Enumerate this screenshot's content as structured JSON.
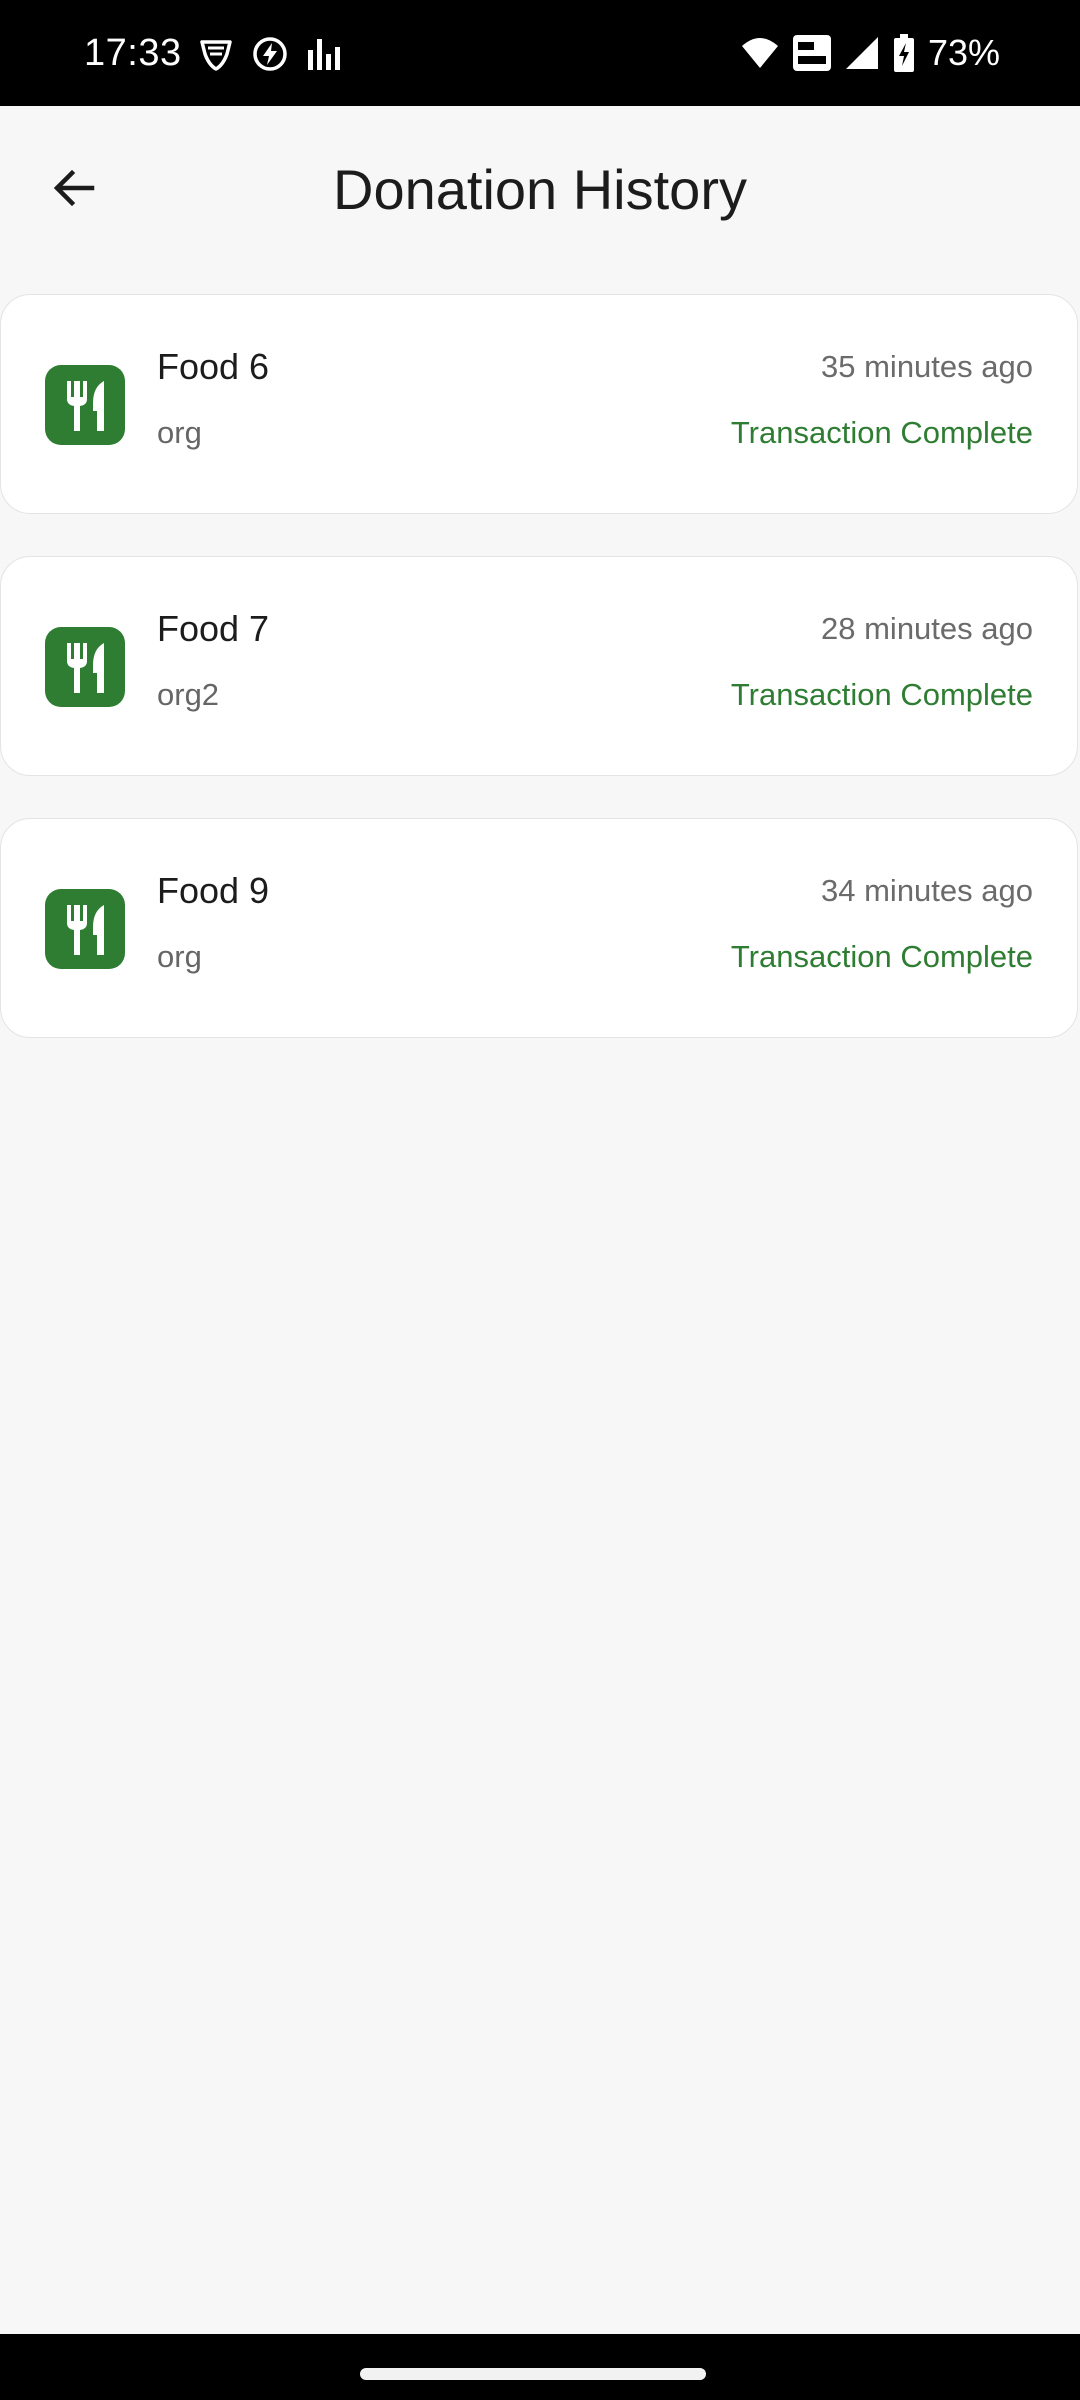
{
  "status_bar": {
    "time": "17:33",
    "battery": "73%",
    "left_icons": [
      "vpn-shield-icon",
      "bolt-icon",
      "bars-icon"
    ],
    "right_icons": [
      "wifi-icon",
      "vowifi-icon",
      "signal-icon",
      "battery-charging-icon"
    ]
  },
  "app_bar": {
    "title": "Donation History",
    "back_icon": "arrow-left-icon"
  },
  "donations": [
    {
      "title": "Food 6",
      "org": "org",
      "time": "35 minutes ago",
      "status": "Transaction Complete",
      "icon": "restaurant-icon"
    },
    {
      "title": "Food 7",
      "org": "org2",
      "time": "28 minutes ago",
      "status": "Transaction Complete",
      "icon": "restaurant-icon"
    },
    {
      "title": "Food 9",
      "org": "org",
      "time": "34 minutes ago",
      "status": "Transaction Complete",
      "icon": "restaurant-icon"
    }
  ],
  "colors": {
    "accent": "#2e7d32",
    "background": "#f7f7f7",
    "card": "#ffffff"
  }
}
